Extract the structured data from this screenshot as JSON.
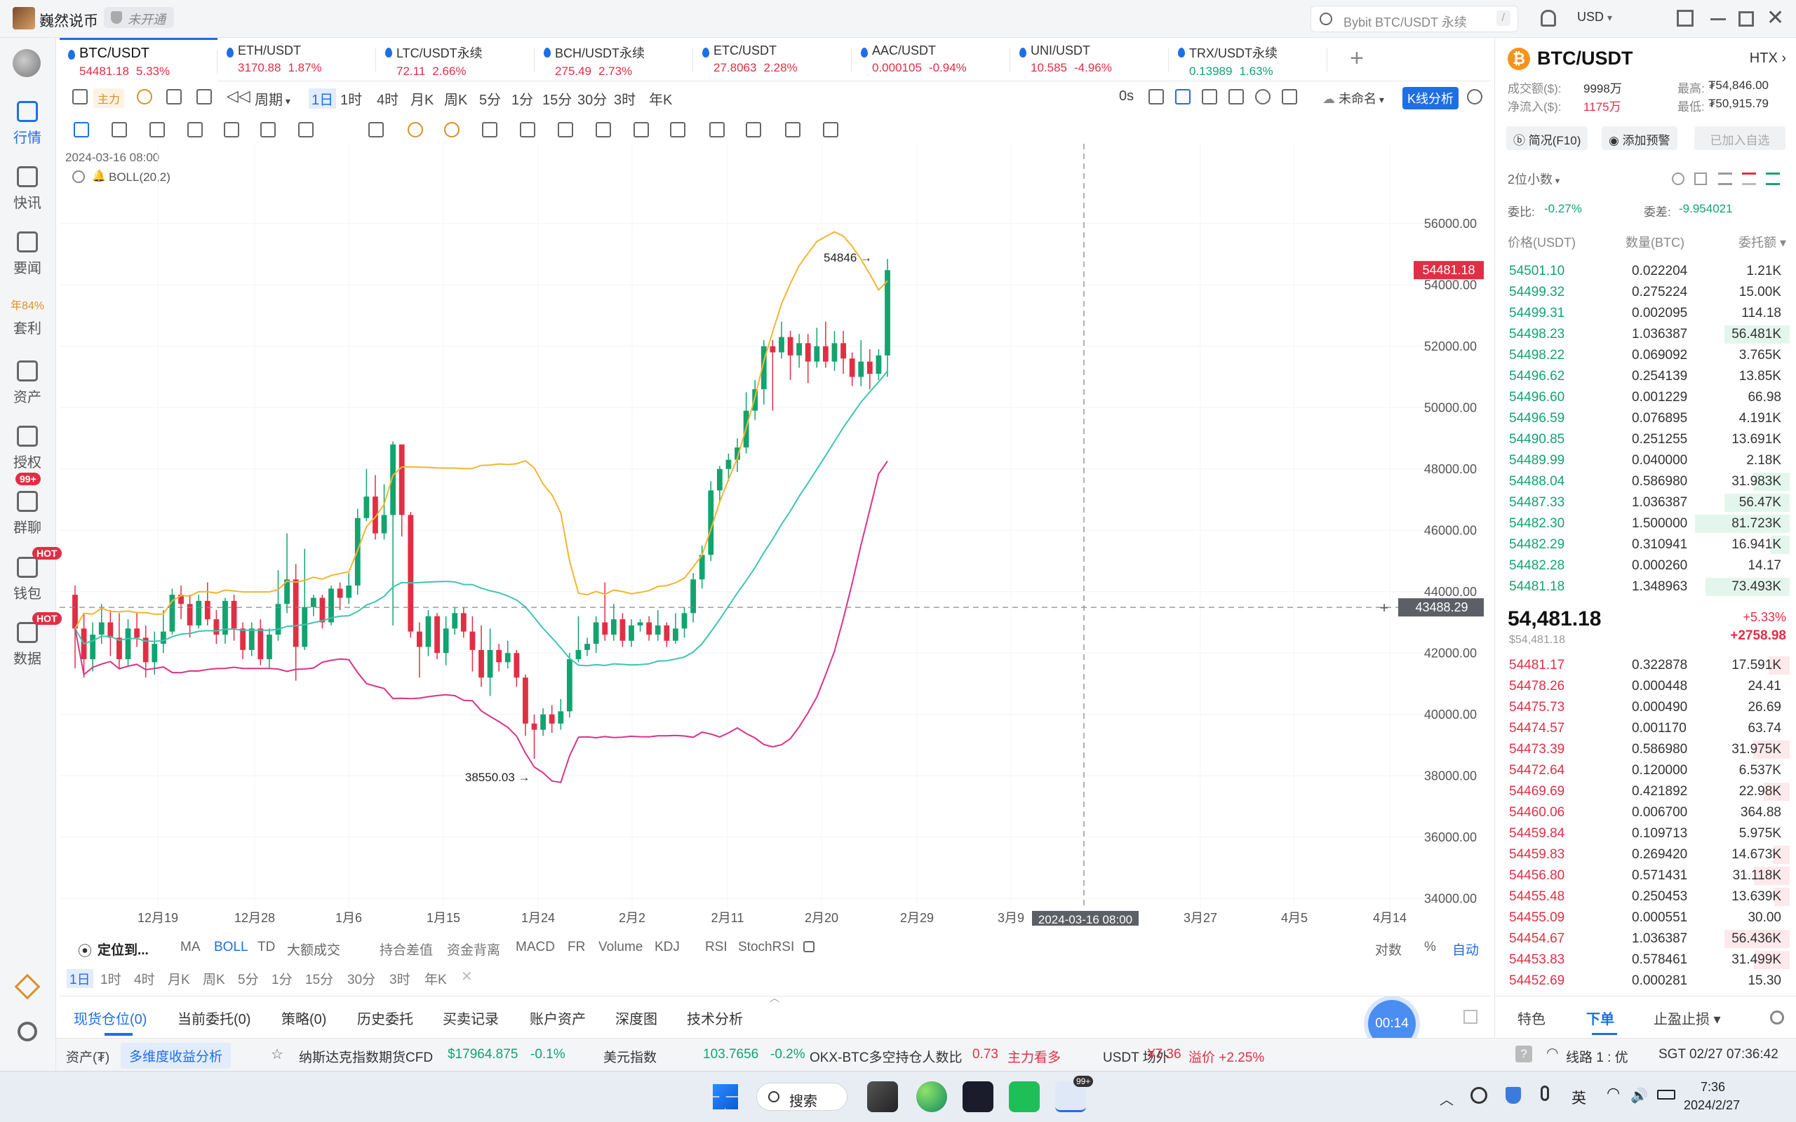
{
  "titlebar": {
    "user_name": "巍然说币",
    "account_status": "未开通",
    "search_placeholder": "Bybit BTC/USDT 永续",
    "search_shortcut": "/",
    "currency": "USD"
  },
  "sidebar": {
    "items": [
      {
        "label": "行情"
      },
      {
        "label": "快讯"
      },
      {
        "label": "要闻"
      },
      {
        "label": "套利",
        "extra": "年84%"
      },
      {
        "label": "资产"
      },
      {
        "label": "授权"
      },
      {
        "label": "群聊",
        "badge": "99+"
      },
      {
        "label": "钱包",
        "badge": "HOT"
      },
      {
        "label": "数据",
        "badge": "HOT"
      }
    ]
  },
  "tabs": [
    {
      "name": "BTC/USDT",
      "price": "54481.18",
      "change": "5.33%",
      "dir": "up"
    },
    {
      "name": "ETH/USDT",
      "price": "3170.88",
      "change": "1.87%",
      "dir": "up"
    },
    {
      "name": "LTC/USDT永续",
      "price": "72.11",
      "change": "2.66%",
      "dir": "up"
    },
    {
      "name": "BCH/USDT永续",
      "price": "275.49",
      "change": "2.73%",
      "dir": "up"
    },
    {
      "name": "ETC/USDT",
      "price": "27.8063",
      "change": "2.28%",
      "dir": "up"
    },
    {
      "name": "AAC/USDT",
      "price": "0.000105",
      "change": "-0.94%",
      "dir": "down"
    },
    {
      "name": "UNI/USDT",
      "price": "10.585",
      "change": "-4.96%",
      "dir": "down"
    },
    {
      "name": "TRX/USDT永续",
      "price": "0.13989",
      "change": "1.63%",
      "dir": "up"
    }
  ],
  "toolbar": {
    "main_force": "主力",
    "period_label": "周期",
    "periods": [
      "1日",
      "1时",
      "4时",
      "月K",
      "周K",
      "5分",
      "1分",
      "15分",
      "30分",
      "3时",
      "年K"
    ],
    "latency": "0s",
    "unnamed": "未命名",
    "kline_analysis": "K线分析"
  },
  "chart": {
    "timestamp": "2024-03-16 08:00",
    "indicator": "BOLL(20,2)",
    "high_label": "54846",
    "low_label": "38550.03",
    "current_price_label": "54481.18",
    "crosshair_price_label": "43488.29",
    "crosshair_date_label": "2024-03-16 08:00",
    "bottom_indicators": [
      "定位到...",
      "MA",
      "BOLL",
      "TD",
      "大额成交",
      "持合差值",
      "资金背离",
      "MACD",
      "FR",
      "Volume",
      "KDJ",
      "RSI",
      "StochRSI"
    ],
    "scale_options": [
      "对数",
      "%",
      "自动"
    ],
    "bottom_periods": [
      "1日",
      "1时",
      "4时",
      "月K",
      "周K",
      "5分",
      "1分",
      "15分",
      "30分",
      "3时",
      "年K"
    ]
  },
  "chart_data": {
    "type": "candlestick",
    "yaxis_ticks": [
      34000,
      36000,
      38000,
      40000,
      42000,
      44000,
      46000,
      48000,
      50000,
      52000,
      54000,
      56000
    ],
    "ylim": [
      33000,
      57000
    ],
    "xaxis_ticks": [
      "12月19",
      "12月28",
      "1月6",
      "1月15",
      "1月24",
      "2月2",
      "2月11",
      "2月20",
      "2月29",
      "3月9",
      "3月27",
      "4月5",
      "4月14"
    ],
    "colors": {
      "up": "#13a36f",
      "down": "#e02f44",
      "boll_up": "#f2b630",
      "boll_mid": "#40c4b0",
      "boll_low": "#d9328a"
    },
    "candles": [
      [
        43900,
        42800,
        44200,
        41500
      ],
      [
        42800,
        41800,
        43300,
        41200
      ],
      [
        41800,
        42600,
        43000,
        41400
      ],
      [
        42600,
        43000,
        43600,
        42300
      ],
      [
        43000,
        42500,
        43400,
        41900
      ],
      [
        42500,
        41800,
        43300,
        41500
      ],
      [
        41800,
        42800,
        43100,
        41600
      ],
      [
        42800,
        42500,
        43300,
        42200
      ],
      [
        42500,
        41700,
        42900,
        41200
      ],
      [
        41700,
        42300,
        42700,
        41300
      ],
      [
        42300,
        42700,
        43400,
        42000
      ],
      [
        42700,
        43900,
        44100,
        42600
      ],
      [
        43900,
        43600,
        44200,
        43100
      ],
      [
        43600,
        42900,
        43900,
        42500
      ],
      [
        42900,
        43700,
        43900,
        42800
      ],
      [
        43700,
        43100,
        44300,
        42900
      ],
      [
        43100,
        42600,
        43400,
        42300
      ],
      [
        42600,
        43700,
        43800,
        42300
      ],
      [
        43700,
        42800,
        43900,
        42400
      ],
      [
        42800,
        42100,
        43000,
        41800
      ],
      [
        42100,
        42800,
        43000,
        41900
      ],
      [
        42800,
        41800,
        43100,
        41600
      ],
      [
        41800,
        42600,
        42800,
        41500
      ],
      [
        42600,
        43600,
        44700,
        42400
      ],
      [
        43600,
        44400,
        45900,
        43300
      ],
      [
        44400,
        42200,
        44900,
        41100
      ],
      [
        42200,
        43500,
        45400,
        42100
      ],
      [
        43500,
        43800,
        43900,
        43200
      ],
      [
        43800,
        43000,
        43900,
        42800
      ],
      [
        43000,
        44100,
        44200,
        42900
      ],
      [
        44100,
        43800,
        44300,
        43400
      ],
      [
        43800,
        44200,
        44600,
        43600
      ],
      [
        44200,
        46400,
        46700,
        43900
      ],
      [
        46400,
        47100,
        48000,
        46300
      ],
      [
        47100,
        45900,
        47800,
        45700
      ],
      [
        45900,
        46500,
        47500,
        45700
      ],
      [
        46500,
        48800,
        48900,
        42900
      ],
      [
        48800,
        46500,
        47100,
        45800
      ],
      [
        46500,
        42700,
        46600,
        42500
      ],
      [
        42700,
        42200,
        43000,
        41200
      ],
      [
        42200,
        43200,
        43400,
        41900
      ],
      [
        43200,
        42000,
        43300,
        41800
      ],
      [
        42000,
        42800,
        43200,
        41600
      ],
      [
        42800,
        43300,
        43500,
        42600
      ],
      [
        43300,
        42700,
        43500,
        42500
      ],
      [
        42700,
        42100,
        43200,
        41400
      ],
      [
        42100,
        41200,
        42900,
        40900
      ],
      [
        41200,
        42100,
        42800,
        40600
      ],
      [
        42100,
        41700,
        42300,
        41400
      ],
      [
        41700,
        42000,
        42400,
        41500
      ],
      [
        42000,
        41200,
        42100,
        40900
      ],
      [
        41200,
        39700,
        41300,
        39300
      ],
      [
        39700,
        39500,
        40000,
        38550
      ],
      [
        39500,
        40000,
        40200,
        39300
      ],
      [
        40000,
        39700,
        40300,
        39400
      ],
      [
        39700,
        40100,
        40500,
        39500
      ],
      [
        40100,
        41800,
        42000,
        39900
      ],
      [
        41800,
        42100,
        43200,
        41700
      ],
      [
        42100,
        42300,
        42500,
        41900
      ],
      [
        42300,
        43000,
        43200,
        42000
      ],
      [
        43000,
        42600,
        44300,
        42400
      ],
      [
        42600,
        43100,
        43600,
        42400
      ],
      [
        43100,
        42400,
        43300,
        42200
      ],
      [
        42400,
        42900,
        43100,
        42200
      ],
      [
        42900,
        43000,
        43100,
        42700
      ],
      [
        43000,
        42600,
        43200,
        42400
      ],
      [
        42600,
        42900,
        43400,
        42400
      ],
      [
        42900,
        42400,
        43000,
        42200
      ],
      [
        42400,
        42800,
        43300,
        42300
      ],
      [
        42800,
        43300,
        43500,
        42500
      ],
      [
        43300,
        44400,
        44600,
        43000
      ],
      [
        44400,
        45200,
        45500,
        44100
      ],
      [
        45200,
        47300,
        47600,
        45000
      ],
      [
        47300,
        48000,
        48100,
        46900
      ],
      [
        48000,
        48300,
        48500,
        47600
      ],
      [
        48300,
        48700,
        49000,
        47900
      ],
      [
        48700,
        49900,
        50500,
        48500
      ],
      [
        49900,
        50600,
        50900,
        49600
      ],
      [
        50600,
        52000,
        52200,
        50100
      ],
      [
        52000,
        51800,
        52200,
        49900
      ],
      [
        51800,
        52300,
        52800,
        51600
      ],
      [
        52300,
        51700,
        52500,
        50900
      ],
      [
        51700,
        52100,
        52400,
        51300
      ],
      [
        52100,
        51500,
        52400,
        50800
      ],
      [
        51500,
        52000,
        52600,
        51300
      ],
      [
        52000,
        51500,
        52800,
        51300
      ],
      [
        51500,
        52100,
        52500,
        51200
      ],
      [
        52100,
        51600,
        52500,
        51100
      ],
      [
        51600,
        51000,
        51800,
        50700
      ],
      [
        51000,
        51500,
        52200,
        50700
      ],
      [
        51500,
        51100,
        51900,
        50600
      ],
      [
        51100,
        51700,
        51900,
        50900
      ],
      [
        51700,
        54481,
        54846,
        51000
      ]
    ]
  },
  "orderbook": {
    "pair": "BTC/USDT",
    "exchange": "HTX",
    "volume_label": "成交额($):",
    "volume_value": "9998万",
    "netflow_label": "净流入($):",
    "netflow_value": "1175万",
    "high_label": "最高:",
    "high_value": "₮54,846.00",
    "low_label": "最低:",
    "low_value": "₮50,915.79",
    "btn_brief": "简况(F10)",
    "btn_alert": "添加预警",
    "btn_fav": "已加入自选",
    "decimals": "2位小数",
    "ratio_label": "委比:",
    "ratio_value": "-0.27%",
    "diff_label": "委差:",
    "diff_value": "-9.954021",
    "col_price": "价格(USDT)",
    "col_qty": "数量(BTC)",
    "col_total": "委托额",
    "bids": [
      {
        "p": "54501.10",
        "q": "0.022204",
        "t": "1.21K",
        "w": 0
      },
      {
        "p": "54499.32",
        "q": "0.275224",
        "t": "15.00K",
        "w": 0
      },
      {
        "p": "54499.31",
        "q": "0.002095",
        "t": "114.18",
        "w": 0
      },
      {
        "p": "54498.23",
        "q": "1.036387",
        "t": "56.481K",
        "w": 0.62
      },
      {
        "p": "54498.22",
        "q": "0.069092",
        "t": "3.765K",
        "w": 0
      },
      {
        "p": "54496.62",
        "q": "0.254139",
        "t": "13.85K",
        "w": 0
      },
      {
        "p": "54496.60",
        "q": "0.001229",
        "t": "66.98",
        "w": 0
      },
      {
        "p": "54496.59",
        "q": "0.076895",
        "t": "4.191K",
        "w": 0
      },
      {
        "p": "54490.85",
        "q": "0.251255",
        "t": "13.691K",
        "w": 0
      },
      {
        "p": "54489.99",
        "q": "0.040000",
        "t": "2.18K",
        "w": 0
      },
      {
        "p": "54488.04",
        "q": "0.586980",
        "t": "31.983K",
        "w": 0.35
      },
      {
        "p": "54487.33",
        "q": "1.036387",
        "t": "56.47K",
        "w": 0.62
      },
      {
        "p": "54482.30",
        "q": "1.500000",
        "t": "81.723K",
        "w": 0.9
      },
      {
        "p": "54482.29",
        "q": "0.310941",
        "t": "16.941K",
        "w": 0.18
      },
      {
        "p": "54482.28",
        "q": "0.000260",
        "t": "14.17",
        "w": 0
      },
      {
        "p": "54481.18",
        "q": "1.348963",
        "t": "73.493K",
        "w": 0.8
      }
    ],
    "last_price": "54,481.18",
    "last_price_usd": "$54,481.18",
    "last_change_pct": "+5.33%",
    "last_change_abs": "+2758.98",
    "asks": [
      {
        "p": "54481.17",
        "q": "0.322878",
        "t": "17.591K",
        "w": 0.2
      },
      {
        "p": "54478.26",
        "q": "0.000448",
        "t": "24.41",
        "w": 0
      },
      {
        "p": "54475.73",
        "q": "0.000490",
        "t": "26.69",
        "w": 0
      },
      {
        "p": "54474.57",
        "q": "0.001170",
        "t": "63.74",
        "w": 0
      },
      {
        "p": "54473.39",
        "q": "0.586980",
        "t": "31.975K",
        "w": 0.35
      },
      {
        "p": "54472.64",
        "q": "0.120000",
        "t": "6.537K",
        "w": 0
      },
      {
        "p": "54469.69",
        "q": "0.421892",
        "t": "22.98K",
        "w": 0.25
      },
      {
        "p": "54460.06",
        "q": "0.006700",
        "t": "364.88",
        "w": 0
      },
      {
        "p": "54459.84",
        "q": "0.109713",
        "t": "5.975K",
        "w": 0
      },
      {
        "p": "54459.83",
        "q": "0.269420",
        "t": "14.673K",
        "w": 0.16
      },
      {
        "p": "54456.80",
        "q": "0.571431",
        "t": "31.118K",
        "w": 0.34
      },
      {
        "p": "54455.48",
        "q": "0.250453",
        "t": "13.639K",
        "w": 0.15
      },
      {
        "p": "54455.09",
        "q": "0.000551",
        "t": "30.00",
        "w": 0
      },
      {
        "p": "54454.67",
        "q": "1.036387",
        "t": "56.436K",
        "w": 0.62
      },
      {
        "p": "54453.83",
        "q": "0.578461",
        "t": "31.499K",
        "w": 0.34
      },
      {
        "p": "54452.69",
        "q": "0.000281",
        "t": "15.30",
        "w": 0
      }
    ],
    "bottom_tabs": [
      "特色",
      "下单",
      "止盈止损"
    ]
  },
  "bottom": {
    "tabs": [
      "现货仓位(0)",
      "当前委托(0)",
      "策略(0)",
      "历史委托",
      "买卖记录",
      "账户资产",
      "深度图",
      "技术分析"
    ],
    "timer": "00:14"
  },
  "statusbar": {
    "assets": "资产(₮)",
    "multi_analysis": "多维度收益分析",
    "nasdaq_label": "纳斯达克指数期货CFD",
    "nasdaq_value": "$17964.875",
    "nasdaq_change": "-0.1%",
    "usd_label": "美元指数",
    "usd_value": "103.7656",
    "usd_change": "-0.2%",
    "okx_label": "OKX-BTC多空持仓人数比",
    "okx_value": "0.73",
    "okx_note": "主力看多",
    "usdt_label": "USDT 场外",
    "usdt_value": "¥7.36",
    "usdt_premium": "溢价 +2.25%",
    "line": "线路 1 : 优",
    "time": "SGT 02/27 07:36:42"
  },
  "taskbar": {
    "search": "搜索",
    "tray_lang": "英",
    "clock_time": "7:36",
    "clock_date": "2024/2/27",
    "badge": "99+"
  }
}
